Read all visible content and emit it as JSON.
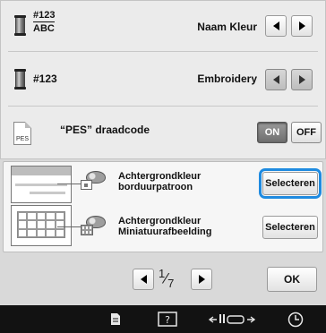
{
  "rows": {
    "thread_number": {
      "code_top": "#123",
      "code_bottom": "ABC",
      "value": "Naam Kleur"
    },
    "thread_brand": {
      "code": "#123",
      "value": "Embroidery"
    },
    "pes_code": {
      "icon_text": "PES",
      "label": "“PES” draadcode",
      "on_label": "ON",
      "off_label": "OFF",
      "state": "on"
    }
  },
  "background": {
    "pattern": {
      "label_line1": "Achtergrondkleur",
      "label_line2": "borduurpatroon",
      "button": "Selecteren",
      "focused": true
    },
    "thumbnail": {
      "label_line1": "Achtergrondkleur",
      "label_line2": "Miniatuurafbeelding",
      "button": "Selecteren"
    }
  },
  "pager": {
    "current": "1",
    "total": "7",
    "ok": "OK"
  },
  "colors": {
    "focus": "#1f8be0",
    "taskbar": "#121212"
  },
  "taskbar": {
    "icons": [
      "document-icon",
      "help-icon",
      "presser-foot-icon",
      "clock-icon"
    ]
  }
}
